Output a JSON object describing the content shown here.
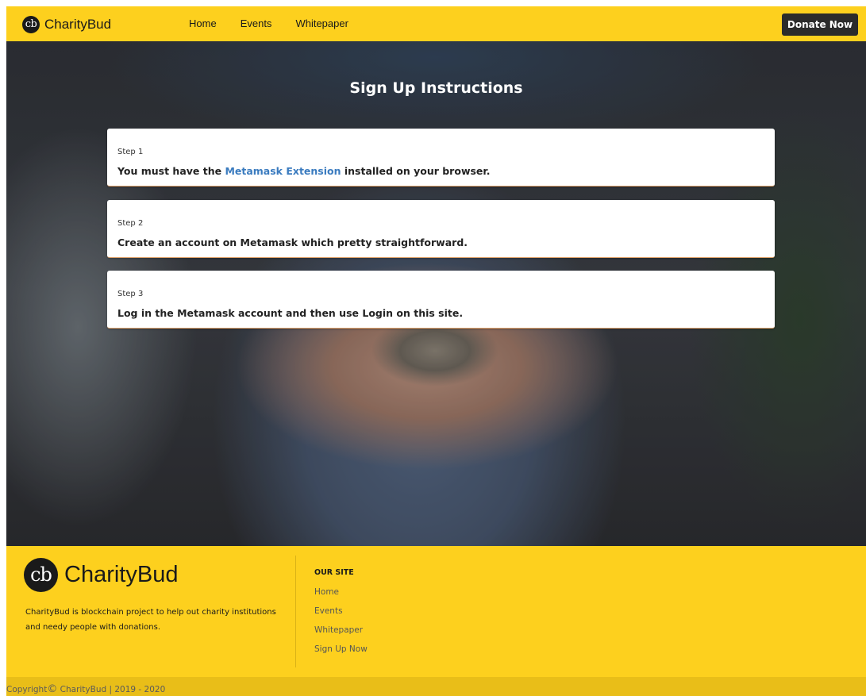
{
  "navbar": {
    "brand_logo_text": "cb",
    "brand_name": "CharityBud",
    "links": [
      "Home",
      "Events",
      "Whitepaper"
    ],
    "donate_label": "Donate Now"
  },
  "hero": {
    "title": "Sign Up Instructions",
    "steps": [
      {
        "label": "Step 1",
        "text_before": "You must have the ",
        "link_text": "Metamask Extension",
        "text_after": " installed on your browser."
      },
      {
        "label": "Step 2",
        "text": "Create an account on Metamask which pretty straightforward."
      },
      {
        "label": "Step 3",
        "text": "Log in the Metamask account and then use Login on this site."
      }
    ]
  },
  "footer": {
    "logo_text": "cb",
    "brand_name": "CharityBud",
    "description": "CharityBud is blockchain project to help out charity institutions and needy people with donations.",
    "our_site_heading": "OUR SITE",
    "links": [
      "Home",
      "Events",
      "Whitepaper",
      "Sign Up Now"
    ],
    "copyright_prefix": "Copyright",
    "copyright_symbol": "©",
    "copyright_text": " CharityBud | 2019 - 2020"
  },
  "colors": {
    "brand_yellow": "#fdd01e",
    "copyright_bar": "#e9be18",
    "button_dark": "#2b2b2b",
    "link_blue": "#3a7bbf"
  },
  "icons": {
    "brand_logo": "cb-logo-icon",
    "copyright": "copyright-icon"
  }
}
